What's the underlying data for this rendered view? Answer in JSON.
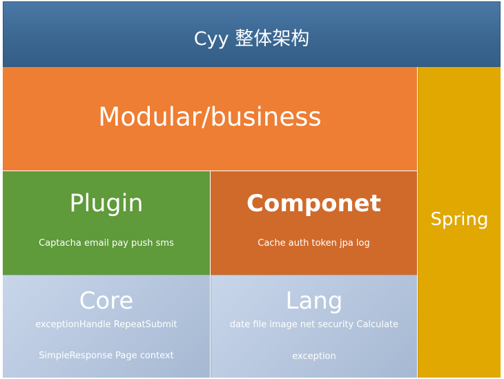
{
  "header": {
    "title": "Cyy 整体架构"
  },
  "modular": {
    "label": "Modular/business"
  },
  "spring": {
    "label": "Spring"
  },
  "plugin": {
    "title": "Plugin",
    "items": "Captacha email pay push sms"
  },
  "componet": {
    "title": "Componet",
    "items": "Cache auth token  jpa log"
  },
  "core": {
    "title": "Core",
    "line1": "exceptionHandle  RepeatSubmit",
    "line2": "SimpleResponse Page context"
  },
  "lang": {
    "title": "Lang",
    "line1": "date file image net security Calculate",
    "line2": "exception"
  },
  "colors": {
    "header": "#3a6690",
    "modular": "#ee7e33",
    "spring": "#e0a800",
    "plugin": "#5f9a3b",
    "componet": "#d06a2a",
    "core_lang": "#b5c5dc"
  }
}
